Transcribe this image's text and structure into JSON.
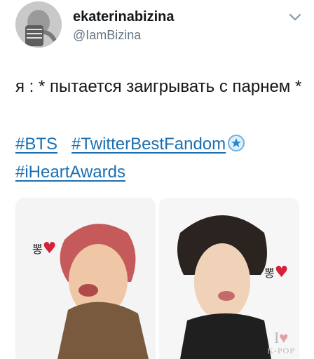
{
  "user": {
    "display_name": "ekaterinabizina",
    "handle": "@IamBizina"
  },
  "tweet": {
    "text": "я : * пытается заигрывать с парнем *",
    "hashtags": [
      "#BTS",
      "#TwitterBestFandom",
      "#iHeartAwards"
    ]
  },
  "media": {
    "left_sticker": "뽕",
    "right_sticker": "뽕",
    "watermark": {
      "line1": "I",
      "line2": "K-POP"
    }
  },
  "colors": {
    "hashtag": "#1b6fb1",
    "heart": "#d42238",
    "handle": "#657786"
  },
  "icons": {
    "caret": "chevron-down-icon",
    "badge": "award-star-icon"
  }
}
